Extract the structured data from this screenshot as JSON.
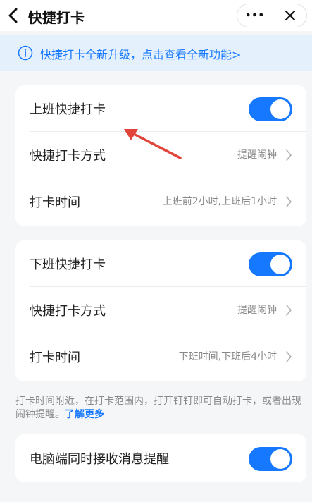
{
  "header": {
    "title": "快捷打卡",
    "more_label": "•••"
  },
  "banner": {
    "text": "快捷打卡全新升级，点击查看全新功能>"
  },
  "section_checkin": {
    "toggle_label": "上班快捷打卡",
    "toggle_on": true,
    "method_label": "快捷打卡方式",
    "method_value": "提醒闹钟",
    "time_label": "打卡时间",
    "time_value": "上班前2小时,上班后1小时"
  },
  "section_checkout": {
    "toggle_label": "下班快捷打卡",
    "toggle_on": true,
    "method_label": "快捷打卡方式",
    "method_value": "提醒闹钟",
    "time_label": "打卡时间",
    "time_value": "下班时间,下班后4小时"
  },
  "note": {
    "text": "打卡时间附近，在打卡范围内，打开钉钉即可自动打卡，或者出现闹钟提醒。",
    "link": "了解更多"
  },
  "section_desktop": {
    "toggle_label": "电脑端同时接收消息提醒",
    "toggle_on": true
  },
  "colors": {
    "accent": "#1677ff",
    "banner_bg": "#e4f1fd",
    "annotation_arrow": "#e0443a"
  }
}
